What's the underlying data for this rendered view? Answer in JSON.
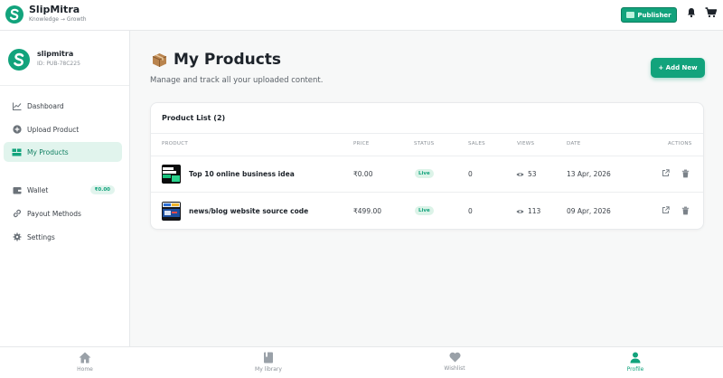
{
  "app": {
    "name": "SlipMitra",
    "tagline": "Knowledge → Growth",
    "publisher_label": "Publisher"
  },
  "profile": {
    "name": "slipmitra",
    "id": "ID: PUB-78C225"
  },
  "sidebar": {
    "items": [
      {
        "label": "Dashboard",
        "icon": "chart-line-icon"
      },
      {
        "label": "Upload Product",
        "icon": "plus-circle-icon"
      },
      {
        "label": "My Products",
        "icon": "boxes-icon",
        "active": true
      },
      {
        "label": "Wallet",
        "icon": "wallet-icon",
        "badge": "₹0.00"
      },
      {
        "label": "Payout Methods",
        "icon": "link-icon"
      },
      {
        "label": "Settings",
        "icon": "gear-icon"
      }
    ]
  },
  "main": {
    "title": "My Products",
    "subtitle": "Manage and track all your uploaded content.",
    "add_button": "+ Add New",
    "card_title": "Product List (2)",
    "columns": [
      "PRODUCT",
      "PRICE",
      "STATUS",
      "SALES",
      "VIEWS",
      "DATE",
      "ACTIONS"
    ],
    "rows": [
      {
        "name": "Top 10 online business idea",
        "price": "₹0.00",
        "status": "Live",
        "sales": "0",
        "views": "53",
        "date": "13 Apr, 2026"
      },
      {
        "name": "news/blog website source code",
        "price": "₹499.00",
        "status": "Live",
        "sales": "0",
        "views": "113",
        "date": "09 Apr, 2026"
      }
    ]
  },
  "bottom_nav": [
    {
      "label": "Home",
      "icon": "home-icon"
    },
    {
      "label": "My library",
      "icon": "book-icon"
    },
    {
      "label": "Wishlist",
      "icon": "heart-icon"
    },
    {
      "label": "Profile",
      "icon": "user-icon",
      "active": true
    }
  ],
  "colors": {
    "accent": "#12a37c",
    "active_bg": "#e1f4ed"
  }
}
